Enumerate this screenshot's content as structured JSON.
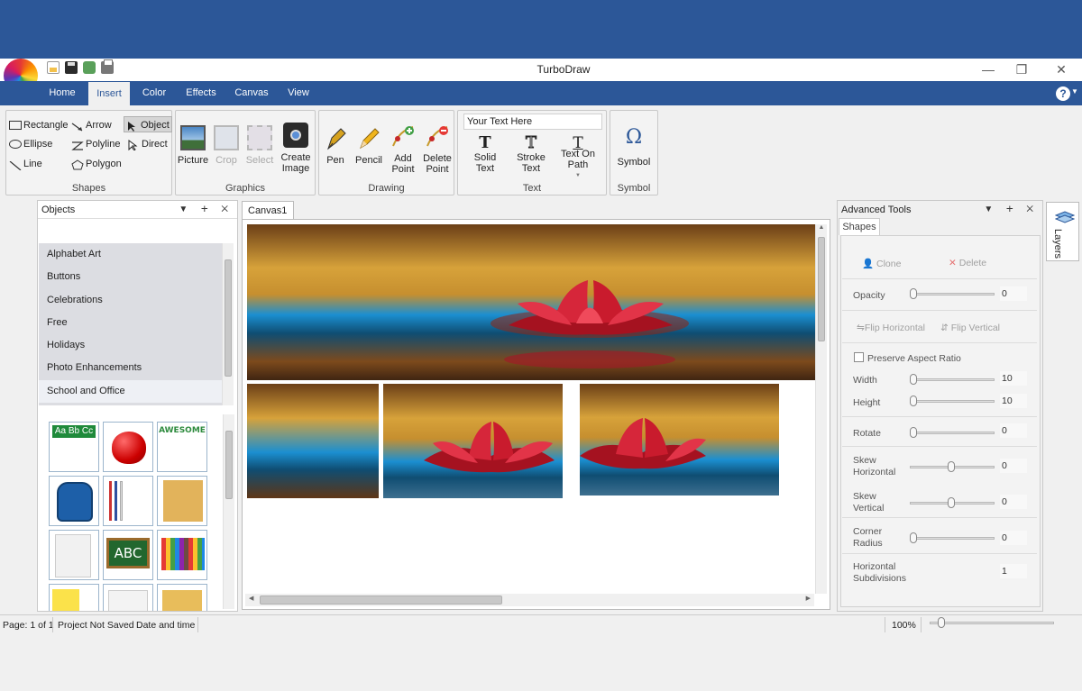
{
  "app": {
    "title": "TurboDraw"
  },
  "window_controls": {
    "minimize": "—",
    "maximize": "❐",
    "close": "✕"
  },
  "menu": {
    "items": [
      "Home",
      "Insert",
      "Color",
      "Effects",
      "Canvas",
      "View"
    ],
    "active": "Insert",
    "help": "?"
  },
  "ribbon": {
    "shapes": {
      "label": "Shapes",
      "tools": [
        "Rectangle",
        "Arrow",
        "Object",
        "Ellipse",
        "Polyline",
        "Direct",
        "Line",
        "Polygon"
      ],
      "active": "Object"
    },
    "graphics": {
      "label": "Graphics",
      "tools": [
        {
          "label": "Picture",
          "enabled": true
        },
        {
          "label": "Crop",
          "enabled": false
        },
        {
          "label": "Select",
          "enabled": false
        },
        {
          "label": "Create Image",
          "enabled": true
        }
      ]
    },
    "drawing": {
      "label": "Drawing",
      "tools": [
        "Pen",
        "Pencil",
        "Add Point",
        "Delete Point"
      ]
    },
    "text": {
      "label": "Text",
      "input_value": "Your Text Here",
      "tools": [
        "Solid Text",
        "Stroke Text",
        "Text On Path"
      ]
    },
    "symbol": {
      "label": "Symbol",
      "button": "Symbol",
      "glyph": "Ω"
    }
  },
  "objects_panel": {
    "title": "Objects",
    "categories": [
      "Alphabet Art",
      "Buttons",
      "Celebrations",
      "Free",
      "Holidays",
      "Photo Enhancements",
      "School and Office"
    ],
    "selected": "School and Office",
    "thumbnails": [
      "Aa Bb Cc",
      "apple",
      "AWESOME",
      "backpack",
      "pens",
      "envelope",
      "binder",
      "ABC",
      "crayons",
      "sticky notes",
      "envelope white",
      "folder"
    ]
  },
  "canvas": {
    "tab": "Canvas1"
  },
  "advanced_tools": {
    "title": "Advanced Tools",
    "tab": "Shapes",
    "clone": "Clone",
    "delete": "Delete",
    "opacity": {
      "label": "Opacity",
      "value": "0"
    },
    "flip_horizontal": "Flip Horizontal",
    "flip_vertical": "Flip Vertical",
    "preserve_aspect": "Preserve Aspect Ratio",
    "width": {
      "label": "Width",
      "value": "10"
    },
    "height": {
      "label": "Height",
      "value": "10"
    },
    "rotate": {
      "label": "Rotate",
      "value": "0"
    },
    "skew_h": {
      "label": "Skew Horizontal",
      "value": "0"
    },
    "skew_v": {
      "label": "Skew Vertical",
      "value": "0"
    },
    "corner_radius": {
      "label": "Corner Radius",
      "value": "0"
    },
    "h_subdivisions": {
      "label": "Horizontal Subdivisions",
      "value": "1"
    }
  },
  "layers": {
    "label": "Layers"
  },
  "status": {
    "page": "Page: 1 of 1",
    "project": "Project Not Saved",
    "datetime": "Date and time",
    "zoom": "100%"
  },
  "colors": {
    "brand": "#2c5798",
    "lotus": "#c91b2d",
    "water": "#1b8fd1",
    "sky": "#c79a2b"
  }
}
